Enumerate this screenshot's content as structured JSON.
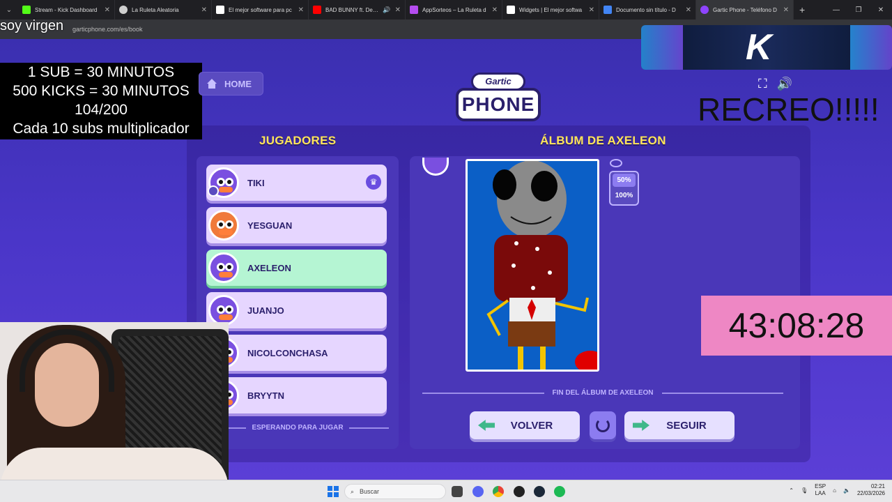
{
  "browser": {
    "tabs": [
      {
        "title": "Stream - Kick Dashboard",
        "color": "#53fc18"
      },
      {
        "title": "La Ruleta Aleatoria",
        "color": "#cfcfcf"
      },
      {
        "title": "El mejor software para pc",
        "color": "#ffffff"
      },
      {
        "title": "BAD BUNNY ft. Dei V",
        "color": "#ff0000"
      },
      {
        "title": "AppSorteos – La Ruleta d",
        "color": "#b44cf0"
      },
      {
        "title": "Widgets | El mejor softwa",
        "color": "#ffffff"
      },
      {
        "title": "Documento sin título - D",
        "color": "#4285f4"
      },
      {
        "title": "Gartic Phone - Teléfono D",
        "color": "#8e44ff"
      }
    ],
    "url": "garticphone.com/es/book"
  },
  "overlay": {
    "soy_text": "soy virgen",
    "subs_lines": [
      "1 SUB      = 30 MINUTOS",
      "500 KICKS = 30 MINUTOS",
      "104/200",
      "Cada 10 subs multiplicador"
    ],
    "recreo": "RECREO!!!!!",
    "timer": "43:08:28"
  },
  "game": {
    "home_label": "HOME",
    "logo_top": "Gartic",
    "logo_main": "PHONE",
    "players_heading": "JUGADORES",
    "album_heading": "ÁLBUM DE AXELEON",
    "players": [
      {
        "name": "TIKI",
        "host": true
      },
      {
        "name": "YESGUAN",
        "host": false
      },
      {
        "name": "AXELEON",
        "host": false,
        "active": true
      },
      {
        "name": "JUANJO",
        "host": false
      },
      {
        "name": "NICOLCONCHASA",
        "host": false
      },
      {
        "name": "BRYYTN",
        "host": false
      }
    ],
    "waiting_label": "ESPERANDO PARA JUGAR",
    "zoom_options": [
      "50%",
      "100%"
    ],
    "zoom_selected": "50%",
    "end_label": "FIN DEL ÁLBUM DE AXELEON",
    "back_label": "VOLVER",
    "next_label": "SEGUIR"
  },
  "taskbar": {
    "search_placeholder": "Buscar",
    "lang_top": "ESP",
    "lang_bottom": "LAA",
    "time": "02:21",
    "date": "22/03/2026"
  }
}
